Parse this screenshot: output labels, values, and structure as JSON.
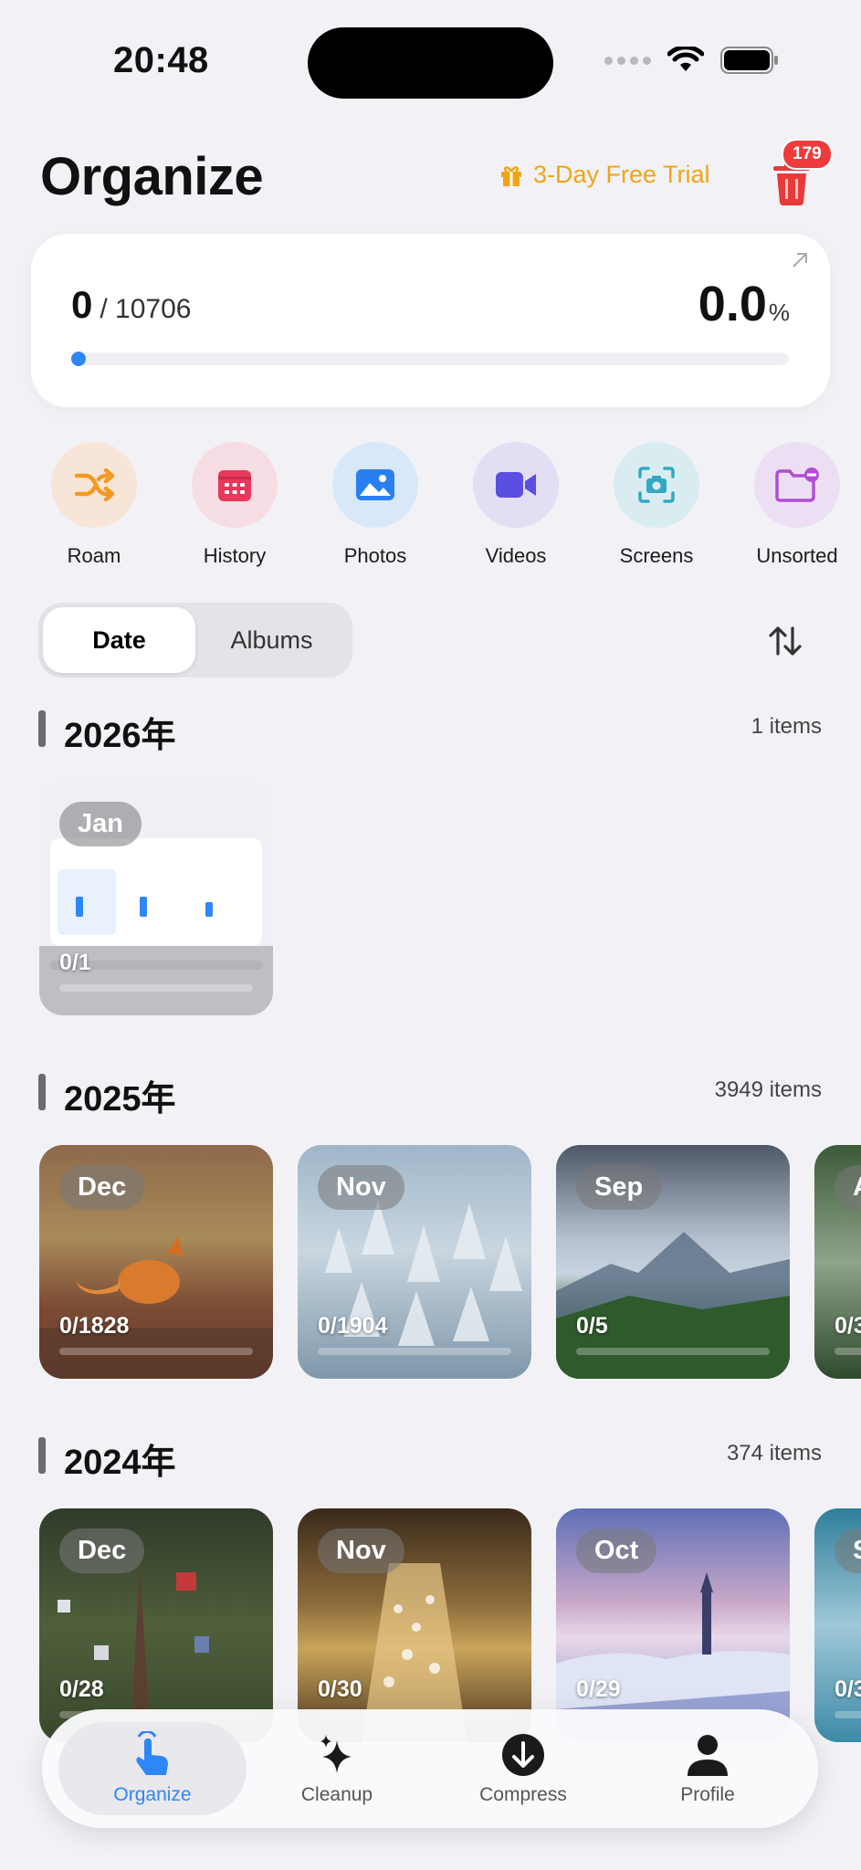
{
  "status_bar": {
    "time": "20:48"
  },
  "header": {
    "title": "Organize",
    "trial_label": "3-Day Free Trial",
    "trash_badge": "179"
  },
  "progress": {
    "done": "0",
    "total": "/ 10706",
    "percent": "0.0",
    "percent_sign": "%",
    "fraction": 0.0
  },
  "categories": [
    {
      "label": "Roam",
      "icon": "shuffle-icon"
    },
    {
      "label": "History",
      "icon": "calendar-icon"
    },
    {
      "label": "Photos",
      "icon": "photo-icon"
    },
    {
      "label": "Videos",
      "icon": "video-icon"
    },
    {
      "label": "Screens",
      "icon": "screenshot-icon"
    },
    {
      "label": "Unsorted",
      "icon": "folder-minus-icon"
    }
  ],
  "segments": {
    "date": "Date",
    "albums": "Albums",
    "selected": "Date"
  },
  "years": [
    {
      "title": "2026年",
      "count": "1 items",
      "cards": [
        {
          "month": "Jan",
          "progress": "0/1"
        }
      ]
    },
    {
      "title": "2025年",
      "count": "3949 items",
      "cards": [
        {
          "month": "Dec",
          "progress": "0/1828"
        },
        {
          "month": "Nov",
          "progress": "0/1904"
        },
        {
          "month": "Sep",
          "progress": "0/5"
        },
        {
          "month": "A",
          "progress": "0/3"
        }
      ]
    },
    {
      "title": "2024年",
      "count": "374 items",
      "cards": [
        {
          "month": "Dec",
          "progress": "0/28"
        },
        {
          "month": "Nov",
          "progress": "0/30"
        },
        {
          "month": "Oct",
          "progress": "0/29"
        },
        {
          "month": "S",
          "progress": "0/3"
        }
      ]
    }
  ],
  "tabs": [
    {
      "label": "Organize",
      "icon": "hand-tap-icon",
      "active": true
    },
    {
      "label": "Cleanup",
      "icon": "sparkles-icon",
      "active": false
    },
    {
      "label": "Compress",
      "icon": "download-circle-icon",
      "active": false
    },
    {
      "label": "Profile",
      "icon": "person-icon",
      "active": false
    }
  ],
  "colors": {
    "accent": "#2f86f6",
    "trial": "#f2a417",
    "badge": "#ee3b3b",
    "background": "#f2f2f6"
  }
}
